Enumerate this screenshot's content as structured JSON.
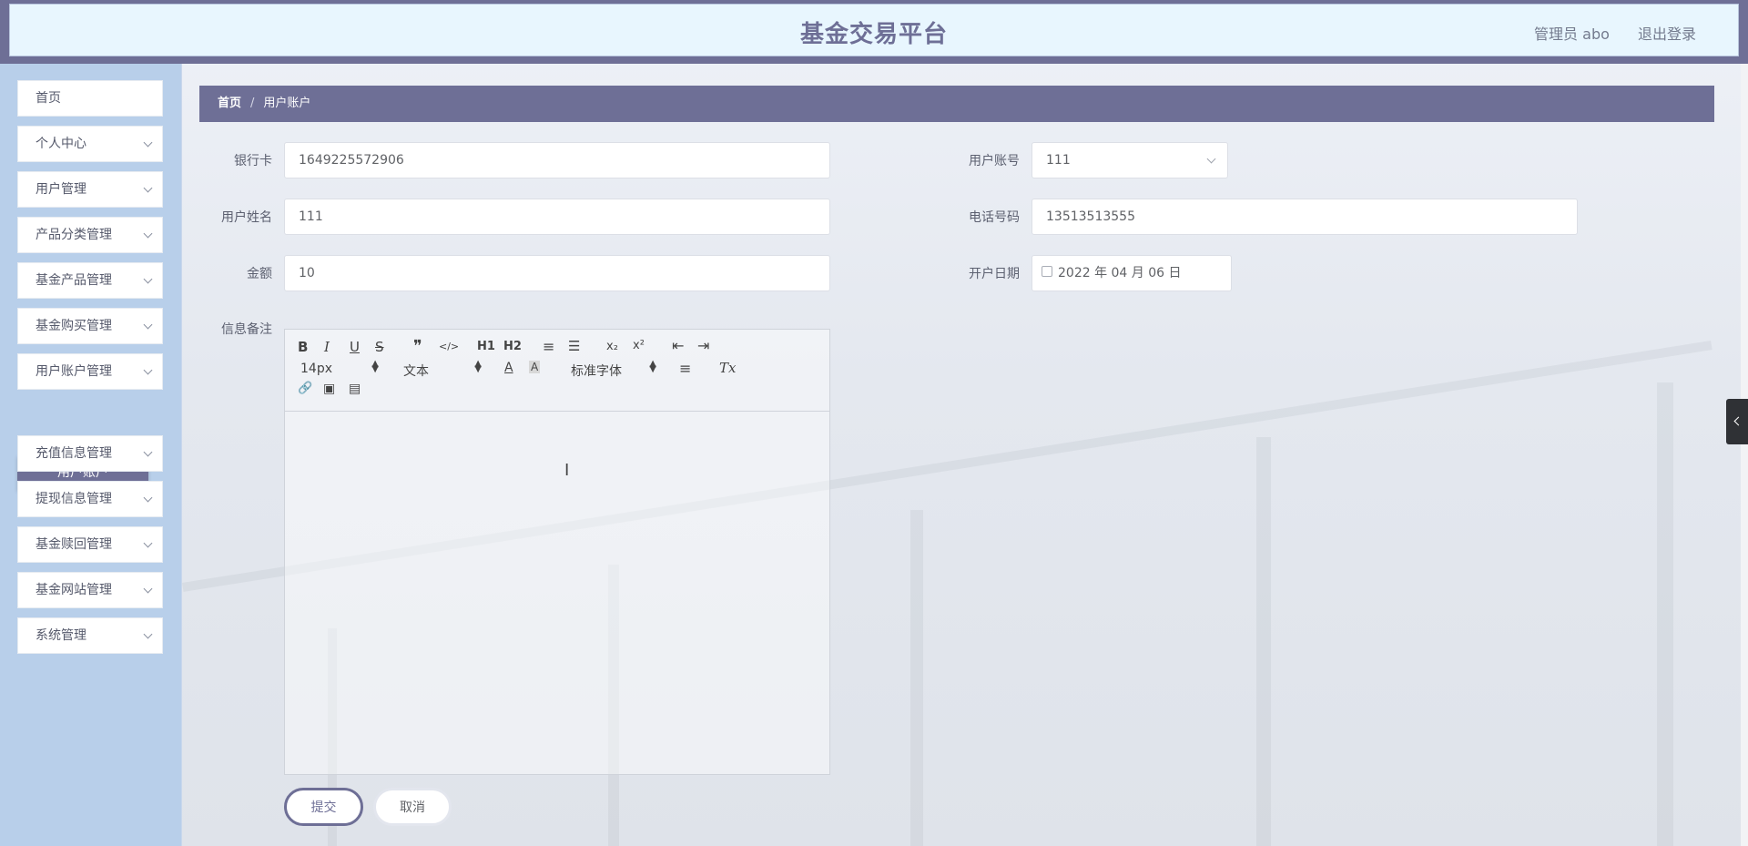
{
  "header": {
    "title": "基金交易平台",
    "user_label": "管理员 abo",
    "logout_label": "退出登录"
  },
  "sidebar": {
    "items": [
      {
        "label": "首页"
      },
      {
        "label": "个人中心"
      },
      {
        "label": "用户管理"
      },
      {
        "label": "产品分类管理"
      },
      {
        "label": "基金产品管理"
      },
      {
        "label": "基金购买管理"
      },
      {
        "label": "用户账户管理"
      },
      {
        "label": "充值信息管理"
      },
      {
        "label": "提现信息管理"
      },
      {
        "label": "基金赎回管理"
      },
      {
        "label": "基金网站管理"
      },
      {
        "label": "系统管理"
      }
    ],
    "active_submenu": "用户账户"
  },
  "breadcrumb": {
    "home": "首页",
    "separator": "/",
    "current": "用户账户"
  },
  "form": {
    "bank_card": {
      "label": "银行卡",
      "value": "1649225572906"
    },
    "user_account": {
      "label": "用户账号",
      "value": "111"
    },
    "user_name": {
      "label": "用户姓名",
      "value": "111"
    },
    "phone": {
      "label": "电话号码",
      "value": "13513513555"
    },
    "amount": {
      "label": "金额",
      "value": "10"
    },
    "open_date": {
      "label": "开户日期",
      "value": "2022 年 04 月 06 日"
    },
    "remark": {
      "label": "信息备注",
      "value": ""
    }
  },
  "editor": {
    "toolbar": {
      "bold": "B",
      "italic": "I",
      "underline": "U",
      "strike": "S",
      "blockquote": "❞",
      "code": "</>",
      "h1": "H1",
      "h2": "H2",
      "ordered_list": "≡",
      "bullet_list": "☰",
      "subscript": "x₂",
      "superscript": "x²",
      "indent_decrease": "⇤",
      "indent_increase": "⇥",
      "size_value": "14px",
      "format_value": "文本",
      "font_value": "标准字体",
      "color": "A",
      "background": "A",
      "align": "≡",
      "clean": "Tx",
      "link": "🔗",
      "image": "▣",
      "video": "▤"
    }
  },
  "buttons": {
    "submit": "提交",
    "cancel": "取消"
  }
}
